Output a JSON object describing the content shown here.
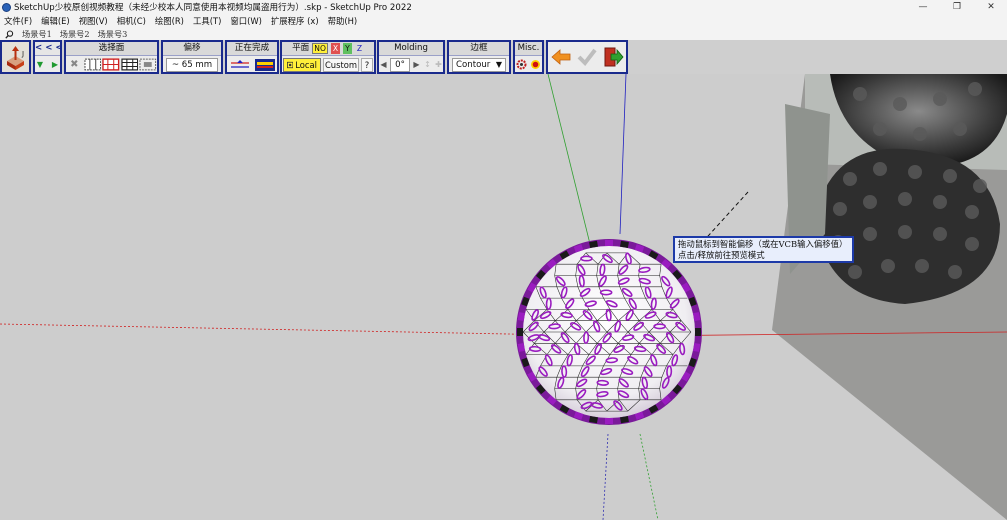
{
  "window": {
    "title": "SketchUp少校原创视频教程（未经少校本人同意使用本视频均属盗用行为）.skp - SketchUp Pro 2022",
    "controls": {
      "minimize": "—",
      "maximize": "❐",
      "close": "✕"
    }
  },
  "menu": [
    "文件(F)",
    "编辑(E)",
    "视图(V)",
    "相机(C)",
    "绘图(R)",
    "工具(T)",
    "窗口(W)",
    "扩展程序 (x)",
    "帮助(H)"
  ],
  "scenes": [
    "场景号1",
    "场景号2",
    "场景号3"
  ],
  "toolbar": {
    "nav": {
      "back": "< < <"
    },
    "select_face": {
      "title": "选择面"
    },
    "offset": {
      "title": "偏移",
      "value": "~ 65 mm"
    },
    "finishing": {
      "title": "正在完成"
    },
    "plane": {
      "title": "平面",
      "no": "NO",
      "x": "X",
      "y": "Y",
      "z": "Z",
      "local": "Local",
      "custom": "Custom",
      "help": "?"
    },
    "molding": {
      "title": "Molding",
      "angle": "0°"
    },
    "border": {
      "title": "边框",
      "value": "Contour"
    },
    "misc": {
      "title": "Misc."
    }
  },
  "tooltip": {
    "line1": "拖动鼠标到智能偏移（或在VCB输入偏移值）",
    "line2": "点击/释放前往预览模式"
  },
  "colors": {
    "toolbar_border": "#1a2a8c",
    "plane_active": "#ffef3a",
    "axis_red": "#d02020",
    "axis_green": "#30a030",
    "axis_blue": "#2020c0",
    "model_purple": "#9a1cc0"
  }
}
